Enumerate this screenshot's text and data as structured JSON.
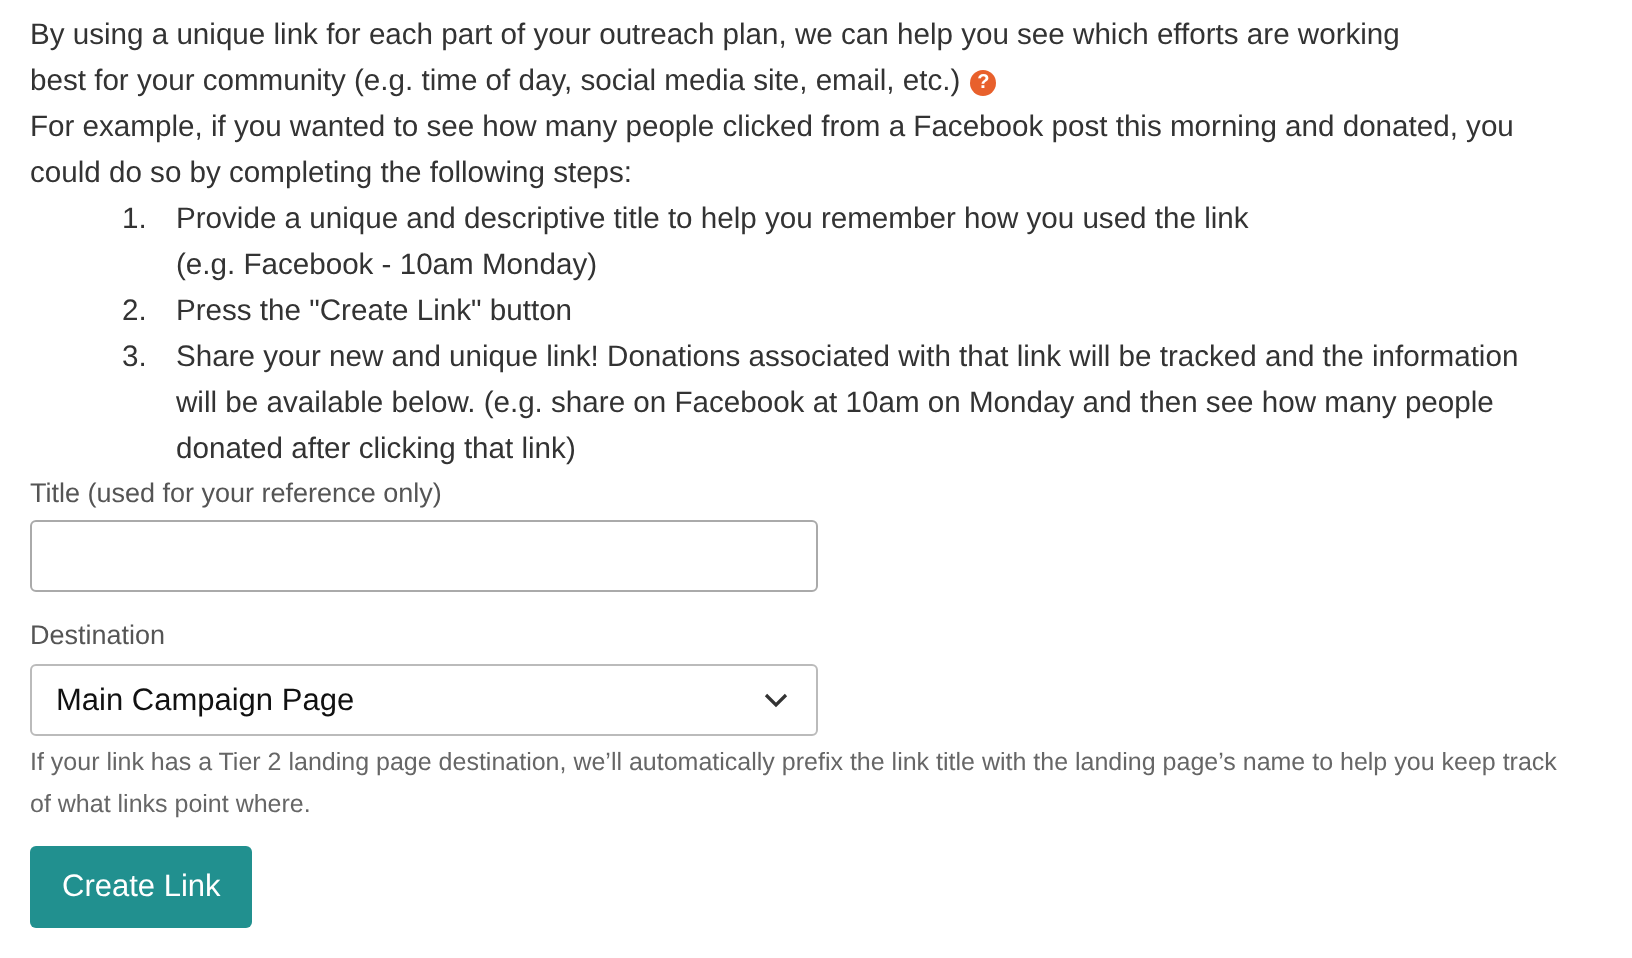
{
  "intro": {
    "lines": [
      "By using a unique link for each part of your outreach plan, we can help you see which efforts are working",
      "best for your community (e.g. time of day, social media site, email, etc.)"
    ],
    "help_icon": "?"
  },
  "example": "For example, if you wanted to see how many people clicked from a Facebook post this morning and donated, you could do so by completing the following steps:",
  "steps": [
    {
      "number": "1.",
      "text": "Provide a unique and descriptive title to help you remember how you used the link\n(e.g. Facebook - 10am Monday)"
    },
    {
      "number": "2.",
      "text": "Press the \"Create Link\" button"
    },
    {
      "number": "3.",
      "text": "Share your new and unique link! Donations associated with that link will be tracked and the information will be available below. (e.g. share on Facebook at 10am on Monday and then see how many people donated after clicking that link)"
    }
  ],
  "title_field": {
    "label": "Title (used for your reference only)"
  },
  "destination": {
    "label": "Destination",
    "value": "Main Campaign Page",
    "help": "If your link has a Tier 2 landing page destination, we’ll automatically prefix the link title with the landing page’s name to help you keep track of what links point where."
  },
  "button": "Create Link"
}
